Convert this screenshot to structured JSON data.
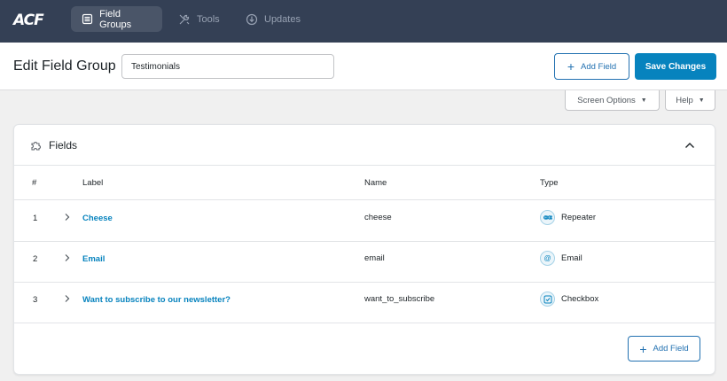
{
  "app": {
    "logo": "ACF"
  },
  "nav": {
    "items": [
      {
        "label": "Field Groups",
        "icon": "field-groups-icon",
        "active": true
      },
      {
        "label": "Tools",
        "icon": "tools-icon",
        "active": false
      },
      {
        "label": "Updates",
        "icon": "updates-icon",
        "active": false
      }
    ]
  },
  "header": {
    "title": "Edit Field Group",
    "group_name_value": "Testimonials",
    "add_field_label": "Add Field",
    "save_label": "Save Changes"
  },
  "screen_tabs": {
    "screen_options_label": "Screen Options",
    "help_label": "Help"
  },
  "panel": {
    "title": "Fields",
    "columns": {
      "num": "#",
      "label": "Label",
      "name": "Name",
      "type": "Type"
    },
    "rows": [
      {
        "num": "1",
        "label": "Cheese",
        "name": "cheese",
        "type": "Repeater",
        "type_icon": "repeater-icon"
      },
      {
        "num": "2",
        "label": "Email",
        "name": "email",
        "type": "Email",
        "type_icon": "email-icon"
      },
      {
        "num": "3",
        "label": "Want to subscribe to our newsletter?",
        "name": "want_to_subscribe",
        "type": "Checkbox",
        "type_icon": "checkbox-icon"
      }
    ],
    "add_field_label": "Add Field"
  },
  "colors": {
    "topbar": "#344055",
    "accent": "#0783be",
    "link": "#2271b1"
  }
}
